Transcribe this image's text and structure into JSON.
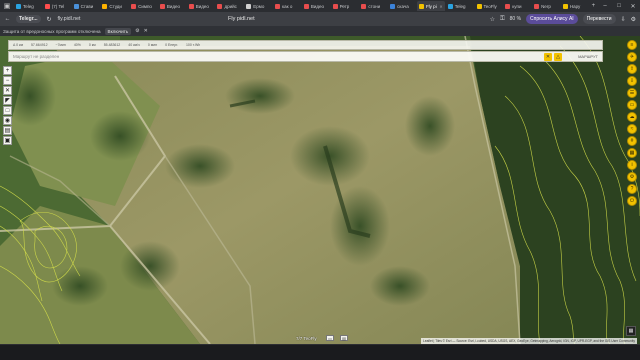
{
  "tabs": [
    {
      "label": "Teleg",
      "color": "#2aa3e0",
      "active": false
    },
    {
      "label": "(7) Tel",
      "color": "#ff4d4d",
      "active": false
    },
    {
      "label": "Стави",
      "color": "#4a90d9",
      "active": false
    },
    {
      "label": "Студи",
      "color": "#ffb300",
      "active": false
    },
    {
      "label": "Симпо",
      "color": "#e84d4d",
      "active": false
    },
    {
      "label": "Видео",
      "color": "#e84d4d",
      "active": false
    },
    {
      "label": "Видео",
      "color": "#e84d4d",
      "active": false
    },
    {
      "label": "дрийс",
      "color": "#e84d4d",
      "active": false
    },
    {
      "label": "Ермо",
      "color": "#d0d0d0",
      "active": false
    },
    {
      "label": "как о",
      "color": "#e84d4d",
      "active": false
    },
    {
      "label": "Видео",
      "color": "#e84d4d",
      "active": false
    },
    {
      "label": "Ретр",
      "color": "#e84d4d",
      "active": false
    },
    {
      "label": "стони",
      "color": "#e84d4d",
      "active": false
    },
    {
      "label": "скача",
      "color": "#3b82d9",
      "active": false
    },
    {
      "label": "Fly pi",
      "color": "#f2c200",
      "active": true
    },
    {
      "label": "Teleg",
      "color": "#2aa3e0",
      "active": false
    },
    {
      "label": "TeoFly",
      "color": "#f2c200",
      "active": false
    },
    {
      "label": "купи",
      "color": "#e84d4d",
      "active": false
    },
    {
      "label": "Nerp",
      "color": "#e84d4d",
      "active": false
    },
    {
      "label": "Нару",
      "color": "#f2c200",
      "active": false
    }
  ],
  "address": {
    "site_label": "Telegr...",
    "host": "fly.pidl.net",
    "page_title": "Fly pidl.net",
    "zoom": "80 %",
    "alice_label": "Спросить Алису AI",
    "translate_label": "Перевести"
  },
  "warning": {
    "text": "Защита от вредоносных программ отключена",
    "enable_label": "Включить"
  },
  "map": {
    "info": [
      "Δ 0 км",
      "57.664912",
      "~7мин",
      "40%",
      "0 км",
      "55.483612",
      "40 км/ч",
      "0 мин",
      "0 Eнерг.",
      "100 т.Wh"
    ],
    "route_placeholder": "Маршрут не разделен",
    "route_right": "МАРШРУТ",
    "stamp": "7/7 TeoFly",
    "attribution": "Leaflet | Tiles © Esri — Source: Esri, i-cubed, USDA, USGS, AEX, GeoEye, Getmapping, Aerogrid, IGN, IGP, UPR-EGP, and the GIS User Community"
  },
  "colors": {
    "accent": "#f2c200",
    "contour": "#d6e04a"
  }
}
